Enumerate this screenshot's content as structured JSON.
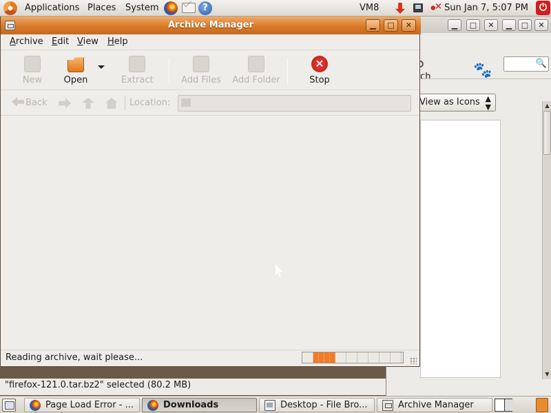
{
  "top_panel": {
    "applications": "Applications",
    "places": "Places",
    "system": "System",
    "vm_label": "VM8",
    "clock": "Sun Jan  7,  5:07 PM",
    "icons": [
      "ubuntu-logo",
      "firefox-icon",
      "mail-icon",
      "help-icon",
      "network-icon",
      "monitor-icon",
      "volume-icon",
      "power-icon"
    ]
  },
  "archive_manager": {
    "title": "Archive Manager",
    "menu": [
      "Archive",
      "Edit",
      "View",
      "Help"
    ],
    "toolbar": {
      "new": "New",
      "open": "Open",
      "extract": "Extract",
      "add_files": "Add Files",
      "add_folder": "Add Folder",
      "stop": "Stop"
    },
    "location": {
      "back": "Back",
      "label": "Location:",
      "value": ""
    },
    "status": "Reading archive, wait please...",
    "progress_fraction": 0.25
  },
  "file_browser": {
    "search_label": "rch",
    "view_select": "View as Icons",
    "status": "\"firefox-121.0.tar.bz2\" selected (80.2 MB)"
  },
  "taskbar": {
    "tasks": [
      {
        "label": "Page Load Error - ...",
        "icon": "firefox-icon",
        "active": false
      },
      {
        "label": "Downloads",
        "icon": "firefox-icon",
        "active": true
      },
      {
        "label": "Desktop - File Bro...",
        "icon": "file-manager-icon",
        "active": false
      },
      {
        "label": "Archive Manager",
        "icon": "archive-manager-icon",
        "active": false
      }
    ]
  },
  "colors": {
    "titlebar_accent": "#d97a28",
    "stop_red": "#d62f1f",
    "progress_fill": "#f07a2a"
  }
}
